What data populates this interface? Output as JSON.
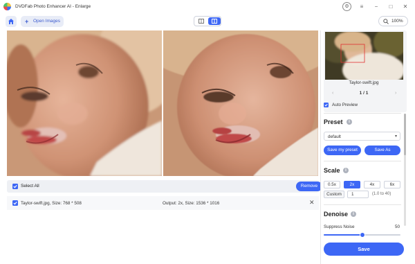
{
  "titlebar": {
    "title": "DVDFab Photo Enhancer AI - Enlarge",
    "controls": [
      "settings-icon",
      "menu-icon",
      "minimize-icon",
      "maximize-icon",
      "close-icon"
    ]
  },
  "toolbar": {
    "home_icon": "home-icon",
    "open_images_label": "Open Images",
    "view_modes": [
      "single-view",
      "split-view"
    ],
    "active_view": "split-view",
    "zoom": "100%"
  },
  "list": {
    "select_all_label": "Select All",
    "remove_label": "Remove",
    "files": [
      {
        "name": "Taylor-swift.jpg, Size: 768 * 508",
        "output": "Output: 2x, Size: 1536 * 1016"
      }
    ]
  },
  "sidebar": {
    "thumbnail_name": "Taylor-swift.jpg",
    "page_indicator": "1 / 1",
    "auto_preview_label": "Auto Preview",
    "auto_preview_checked": true,
    "preset": {
      "title": "Preset",
      "selected": "default",
      "save_my_preset_label": "Save my preset",
      "save_as_label": "Save As"
    },
    "scale": {
      "title": "Scale",
      "options": [
        "0.5x",
        "2x",
        "4x",
        "6x"
      ],
      "active": "2x",
      "custom_label": "Custom",
      "custom_value": "1",
      "custom_range": "(1.0 to 40)"
    },
    "denoise": {
      "title": "Denoise",
      "suppress_label": "Suppress Noise",
      "suppress_value": "50",
      "suppress_fraction": 0.5
    },
    "save_label": "Save"
  },
  "colors": {
    "accent": "#3d67f5",
    "panel_bg": "#f3f4f6",
    "list_bg": "#eef0f4"
  }
}
